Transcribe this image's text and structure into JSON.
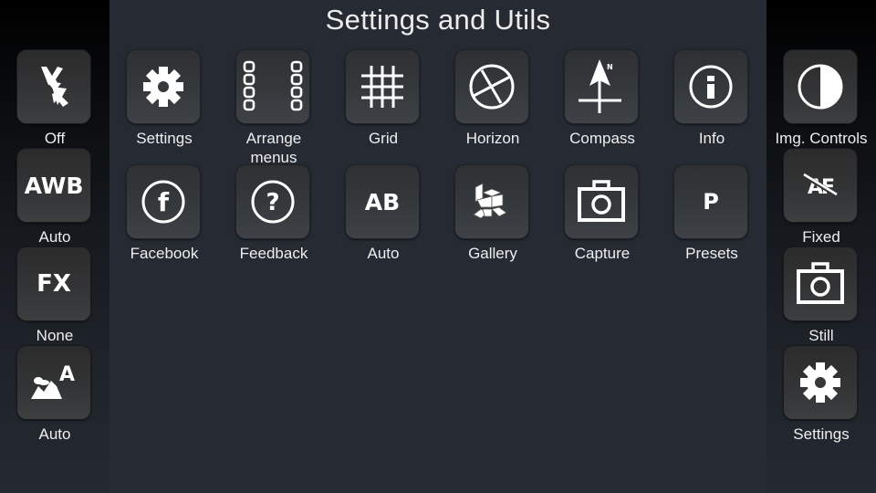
{
  "title": "Settings and Utils",
  "left_panel": {
    "items": [
      {
        "id": "flash",
        "icon": "flash-off-icon",
        "label": "Off"
      },
      {
        "id": "white-balance",
        "icon": "awb-icon",
        "icon_text": "AWB",
        "label": "Auto"
      },
      {
        "id": "effects",
        "icon": "fx-icon",
        "icon_text": "FX",
        "label": "None"
      },
      {
        "id": "scene",
        "icon": "scene-mode-icon",
        "icon_text": "A",
        "label": "Auto"
      }
    ]
  },
  "right_panel": {
    "items": [
      {
        "id": "img-controls",
        "icon": "contrast-icon",
        "label": "Img. Controls"
      },
      {
        "id": "focus",
        "icon": "af-off-icon",
        "icon_text": "AF",
        "label": "Fixed"
      },
      {
        "id": "mode",
        "icon": "camera-icon",
        "label": "Still"
      },
      {
        "id": "settings",
        "icon": "gear-icon",
        "label": "Settings"
      }
    ]
  },
  "grid": {
    "items": [
      {
        "id": "settings",
        "icon": "gear-icon",
        "label": "Settings"
      },
      {
        "id": "arrange-menus",
        "icon": "arrange-menus-icon",
        "label": "Arrange menus",
        "label_lines": [
          "Arrange",
          "menus"
        ]
      },
      {
        "id": "grid",
        "icon": "grid-icon",
        "label": "Grid"
      },
      {
        "id": "horizon",
        "icon": "horizon-icon",
        "label": "Horizon"
      },
      {
        "id": "compass",
        "icon": "compass-icon",
        "icon_text": "N",
        "label": "Compass"
      },
      {
        "id": "info",
        "icon": "info-icon",
        "label": "Info"
      },
      {
        "id": "facebook",
        "icon": "facebook-icon",
        "icon_text": "f",
        "label": "Facebook"
      },
      {
        "id": "feedback",
        "icon": "feedback-icon",
        "icon_text": "?",
        "label": "Feedback"
      },
      {
        "id": "ab-auto",
        "icon": "ab-icon",
        "icon_text": "AB",
        "label": "Auto"
      },
      {
        "id": "gallery",
        "icon": "gallery-icon",
        "label": "Gallery"
      },
      {
        "id": "capture",
        "icon": "camera-icon",
        "label": "Capture"
      },
      {
        "id": "presets",
        "icon": "presets-icon",
        "icon_text": "P",
        "label": "Presets"
      }
    ]
  },
  "colors": {
    "background_center": "#252a33",
    "button_face": "#35383b",
    "icon": "#ffffff",
    "label": "#eeeeee"
  }
}
